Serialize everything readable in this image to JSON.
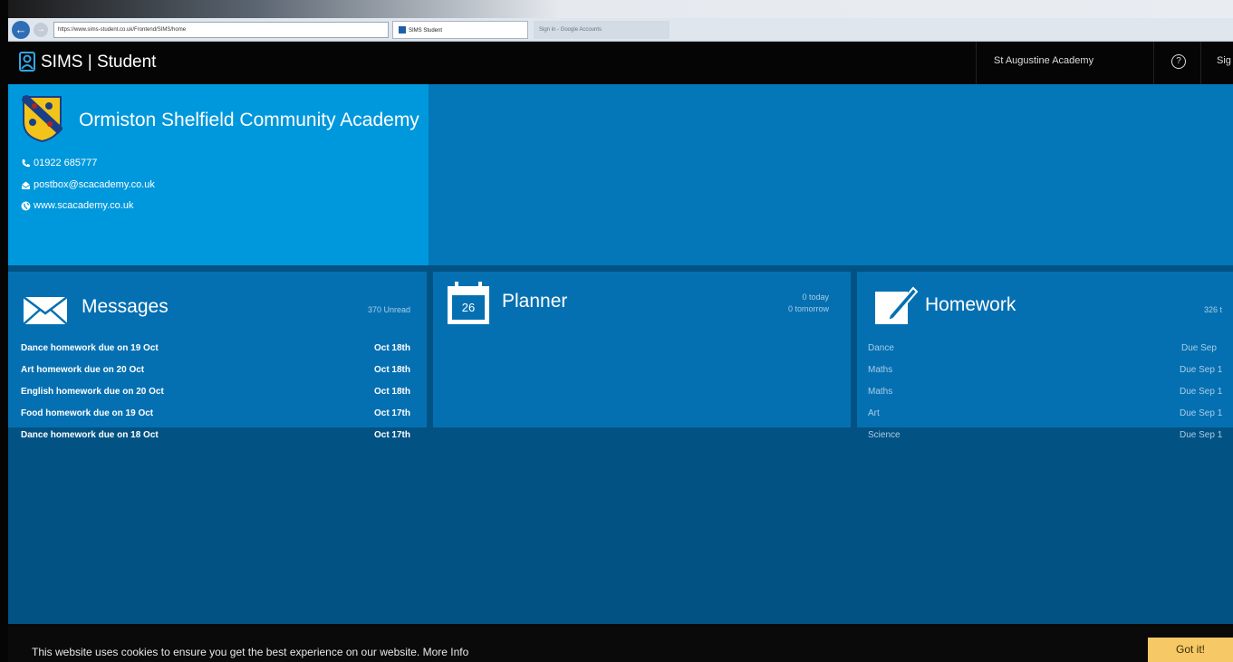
{
  "browser": {
    "address": "https://www.sims-student.co.uk/Frontend/SIMS/home",
    "active_tab": "SIMS Student",
    "inactive_tab": "Sign in - Google Accounts"
  },
  "header": {
    "app_title": "SIMS | Student",
    "school_link": "St Augustine Academy",
    "sign_link": "Sig",
    "help_symbol": "?"
  },
  "school": {
    "name": "Ormiston Shelfield Community Academy",
    "phone": "01922 685777",
    "email": "postbox@scacademy.co.uk",
    "website": "www.scacademy.co.uk"
  },
  "messages": {
    "title": "Messages",
    "unread": "370 Unread",
    "items": [
      {
        "subject": "Dance homework due on 19 Oct",
        "date": "Oct 18th"
      },
      {
        "subject": "Art homework due on 20 Oct",
        "date": "Oct 18th"
      },
      {
        "subject": "English homework due on 20 Oct",
        "date": "Oct 18th"
      },
      {
        "subject": "Food homework due on 19 Oct",
        "date": "Oct 17th"
      },
      {
        "subject": "Dance homework due on 18 Oct",
        "date": "Oct 17th"
      }
    ]
  },
  "planner": {
    "title": "Planner",
    "calendar_day": "26",
    "today": "0 today",
    "tomorrow": "0 tomorrow"
  },
  "homework": {
    "title": "Homework",
    "count": "326 t",
    "items": [
      {
        "subject": "Dance",
        "due": "Due Sep"
      },
      {
        "subject": "Maths",
        "due": "Due Sep 1"
      },
      {
        "subject": "Maths",
        "due": "Due Sep 1"
      },
      {
        "subject": "Art",
        "due": "Due Sep 1"
      },
      {
        "subject": "Science",
        "due": "Due Sep 1"
      }
    ]
  },
  "cookie": {
    "text": "This website uses cookies to ensure you get the best experience on our website.",
    "more_info": "More Info",
    "button": "Got it!"
  },
  "colors": {
    "school_panel": "#0098dc",
    "main_bg": "#035284",
    "tile_bg": "#0570b1",
    "cookie_button": "#f7c966"
  }
}
